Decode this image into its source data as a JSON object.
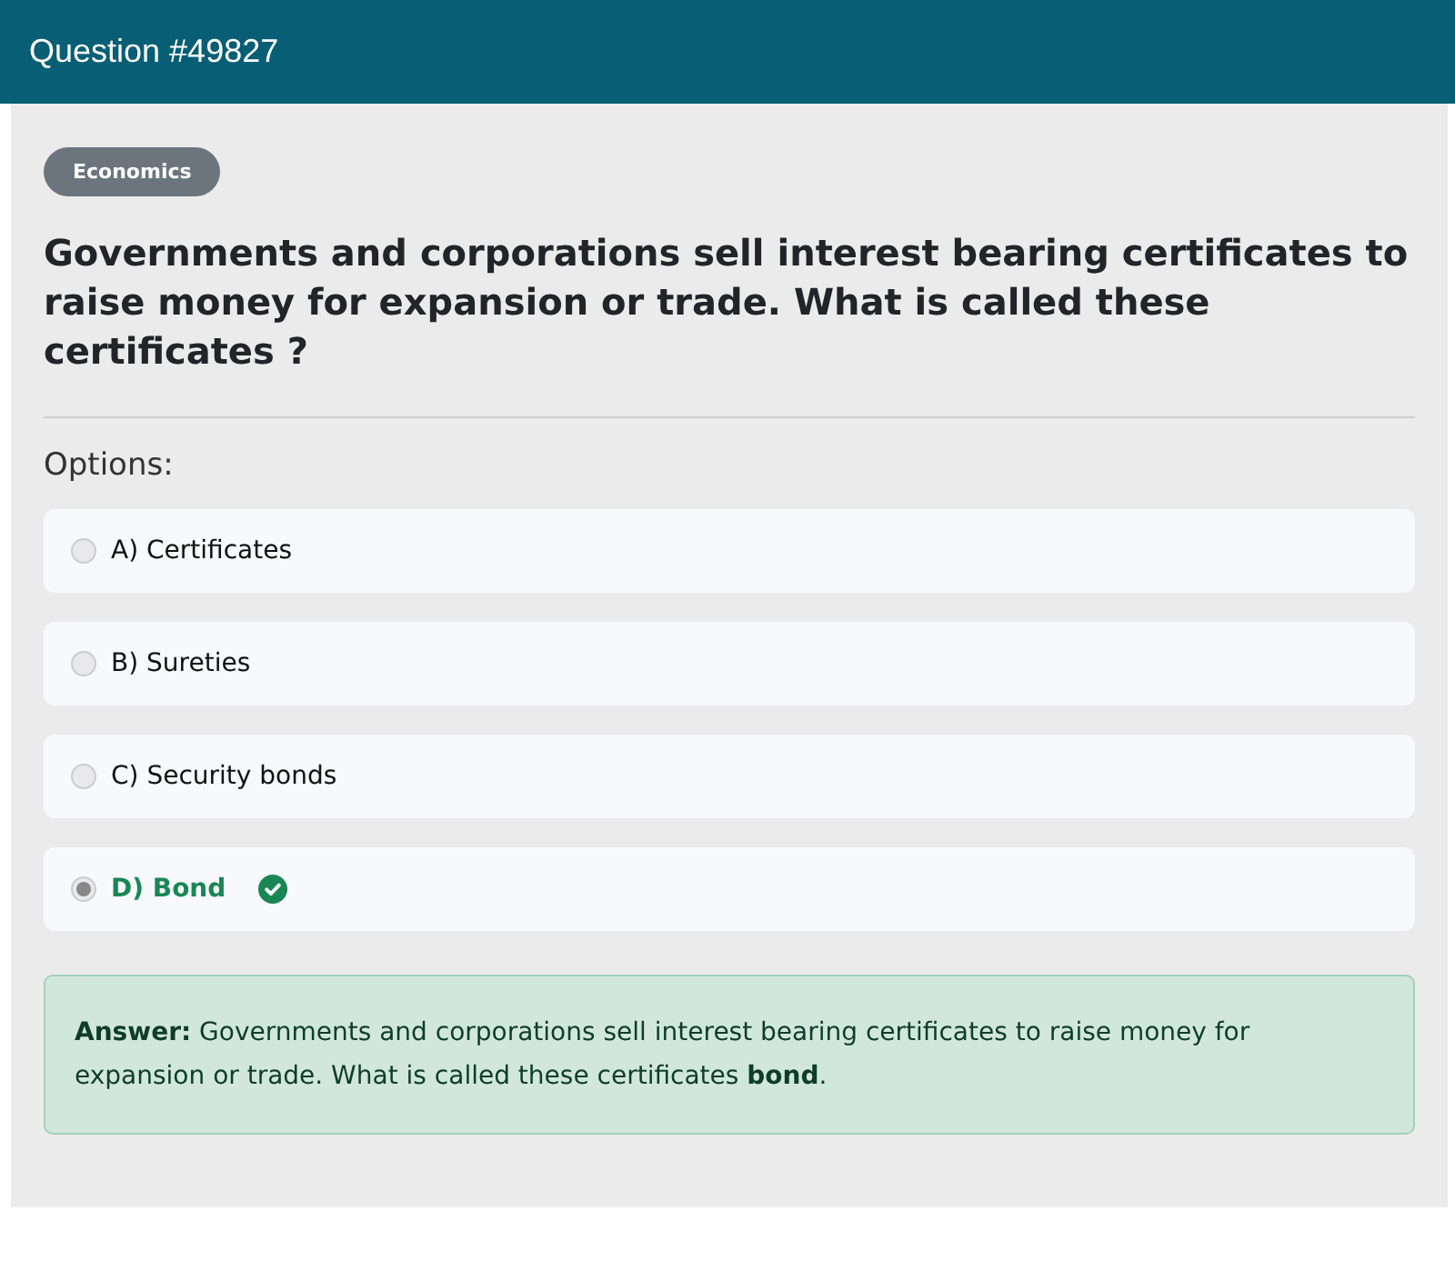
{
  "header": {
    "title": "Question #49827"
  },
  "category": "Economics",
  "question": "Governments and corporations sell interest bearing certificates to raise money for expansion or trade. What is called these certificates ?",
  "options_label": "Options:",
  "options": [
    {
      "label": "A) Certificates",
      "selected": false,
      "correct": false
    },
    {
      "label": "B) Sureties",
      "selected": false,
      "correct": false
    },
    {
      "label": "C) Security bonds",
      "selected": false,
      "correct": false
    },
    {
      "label": "D) Bond",
      "selected": true,
      "correct": true
    }
  ],
  "answer": "**Answer:** Governments and corporations sell interest bearing certificates to raise money for expansion or trade. What is called these certificates **bond**."
}
